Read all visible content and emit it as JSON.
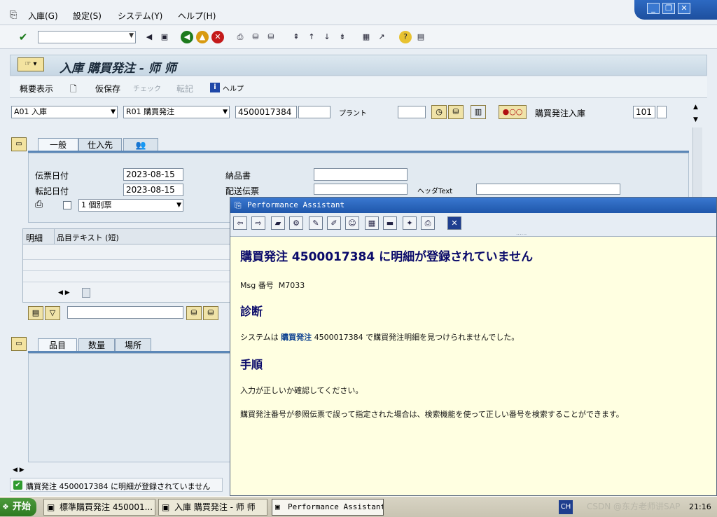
{
  "menu": {
    "items": [
      "入庫(G)",
      "設定(S)",
      "システム(Y)",
      "ヘルプ(H)"
    ]
  },
  "window_controls": [
    "_",
    "❐",
    "✕"
  ],
  "title": "入庫 購買発注 - 师 师",
  "app_toolbar": {
    "overview": "概要表示",
    "hold": "仮保存",
    "check": "チェック",
    "post": "転記",
    "help": "ヘルプ"
  },
  "header": {
    "transaction": "A01 入庫",
    "reference_doc": "R01 購買発注",
    "po_number": "4500017384",
    "plant_label": "プラント",
    "movement_label": "購買発注入庫",
    "movement_type": "101"
  },
  "tabs_top": [
    "一般",
    "仕入先"
  ],
  "general": {
    "doc_date_label": "伝票日付",
    "doc_date": "2023-08-15",
    "post_date_label": "転記日付",
    "post_date": "2023-08-15",
    "delivery_note_label": "納品書",
    "bill_of_lading_label": "配送伝票",
    "header_text_label": "ヘッダText",
    "print_option": "1 個別票"
  },
  "grid": {
    "col_line": "明細",
    "col_text": "品目テキスト (短)"
  },
  "tabs_bottom": [
    "品目",
    "数量",
    "場所"
  ],
  "status": {
    "message": "購買発注 4500017384 に明細が登録されていません"
  },
  "performance_assistant": {
    "title": "Performance Assistant",
    "heading": "購買発注  4500017384 に明細が登録されていません",
    "msg_label": "Msg 番号",
    "msg_number": "M7033",
    "diagnosis_heading": "診断",
    "diagnosis_prefix": "システムは",
    "diagnosis_link": "購買発注",
    "diagnosis_suffix": "4500017384 で購買発注明細を見つけられませんでした。",
    "procedure_heading": "手順",
    "procedure_1": "入力が正しいか確認してください。",
    "procedure_2": "購買発注番号が参照伝票で誤って指定された場合は、検索機能を使って正しい番号を検索することができます。"
  },
  "taskbar": {
    "start": "开始",
    "tasks": [
      "標準購買発注 450001...",
      "入庫 購買発注 - 师 师",
      "Performance Assistant"
    ],
    "lang": "CH",
    "clock": "21:16",
    "watermark": "CSDN @东方老师讲SAP"
  }
}
